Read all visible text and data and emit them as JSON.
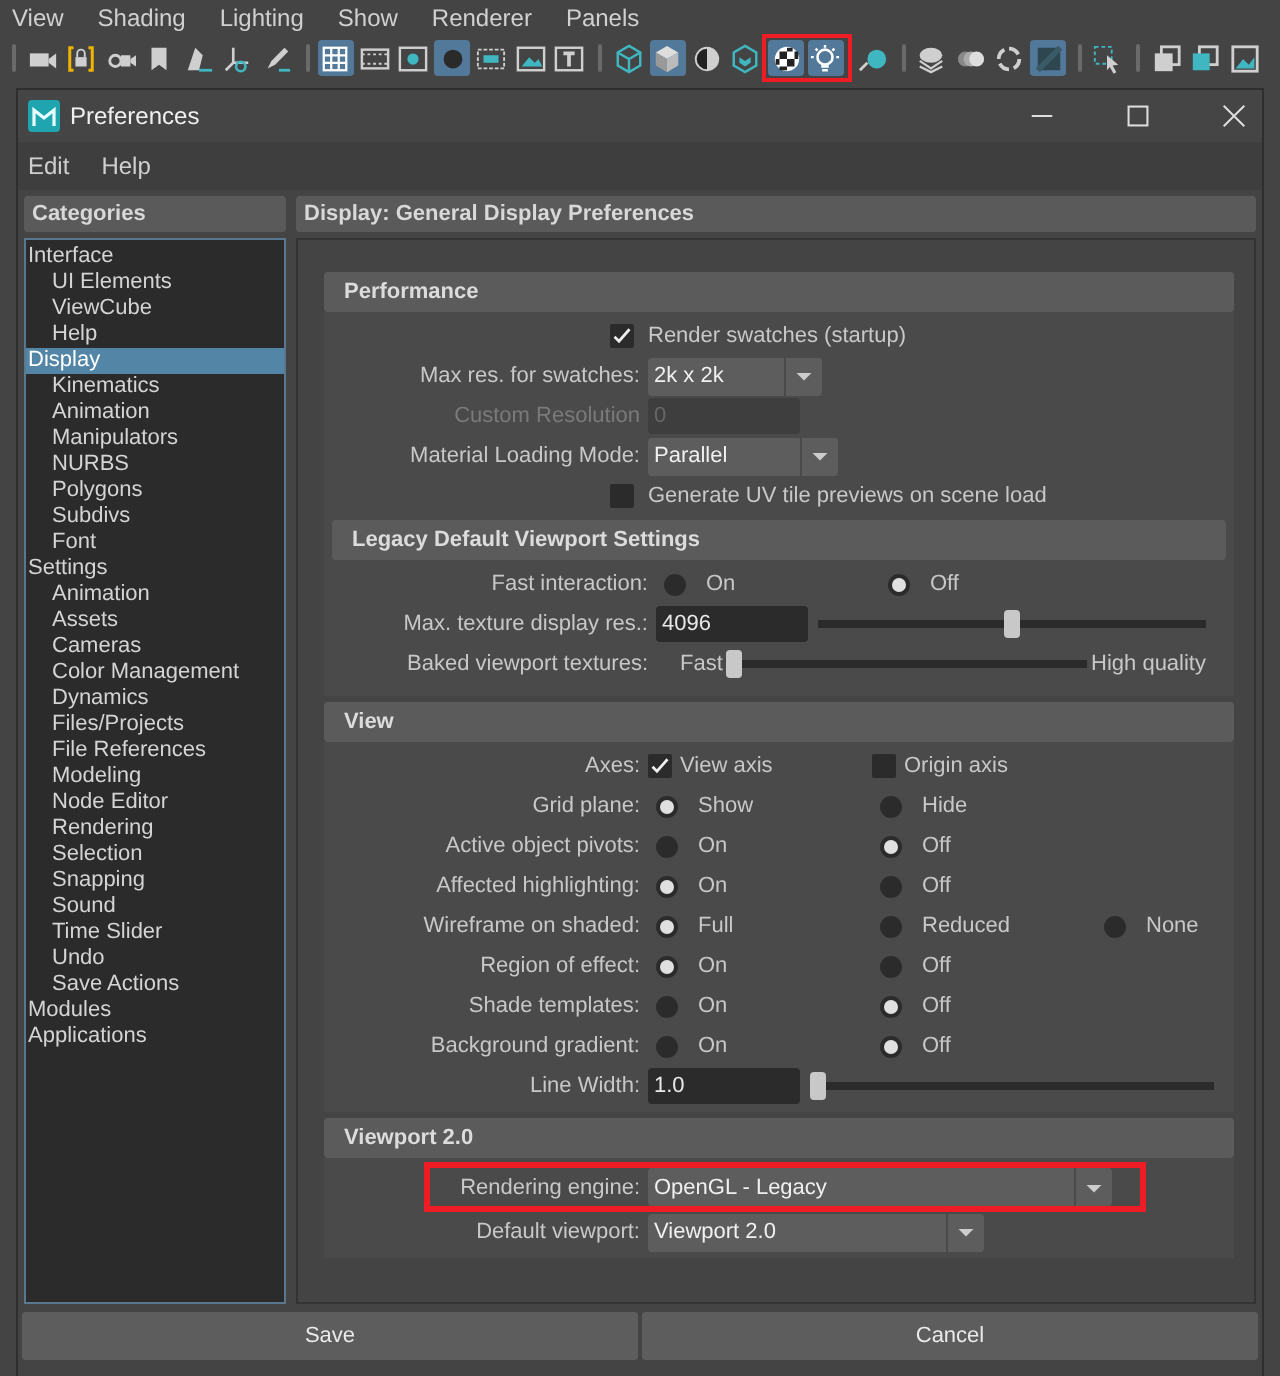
{
  "app_menu": [
    "View",
    "Shading",
    "Lighting",
    "Show",
    "Renderer",
    "Panels"
  ],
  "toolbar": [
    [
      {
        "selected": false
      },
      {
        "selected": false
      },
      {
        "selected": false
      },
      {
        "selected": false
      },
      {
        "selected": false
      },
      {
        "selected": false
      },
      {
        "selected": false
      }
    ],
    [
      {
        "selected": true
      },
      {
        "selected": false
      },
      {
        "selected": false
      },
      {
        "selected": true
      },
      {
        "selected": false
      },
      {
        "selected": false
      },
      {
        "selected": false
      }
    ],
    [
      {
        "selected": false
      },
      {
        "selected": true
      },
      {
        "selected": false
      },
      {
        "selected": false
      },
      {
        "selected": true,
        "highlighted": true
      },
      {
        "selected": true,
        "highlighted": true
      },
      {
        "selected": false
      }
    ],
    [
      {
        "selected": false
      },
      {
        "selected": false
      },
      {
        "selected": false
      },
      {
        "selected": true
      }
    ],
    [
      {
        "selected": false
      }
    ],
    [
      {
        "selected": false
      },
      {
        "selected": false
      },
      {
        "selected": false
      }
    ]
  ],
  "window": {
    "title": "Preferences"
  },
  "menu": [
    "Edit",
    "Help"
  ],
  "categories": {
    "title": "Categories",
    "items": [
      {
        "label": "Interface",
        "selected": false,
        "children": [
          {
            "label": "UI Elements",
            "selected": false
          },
          {
            "label": "ViewCube",
            "selected": false
          },
          {
            "label": "Help",
            "selected": false
          }
        ]
      },
      {
        "label": "Display",
        "selected": true,
        "children": [
          {
            "label": "Kinematics",
            "selected": false
          },
          {
            "label": "Animation",
            "selected": false
          },
          {
            "label": "Manipulators",
            "selected": false
          },
          {
            "label": "NURBS",
            "selected": false
          },
          {
            "label": "Polygons",
            "selected": false
          },
          {
            "label": "Subdivs",
            "selected": false
          },
          {
            "label": "Font",
            "selected": false
          }
        ]
      },
      {
        "label": "Settings",
        "selected": false,
        "children": [
          {
            "label": "Animation",
            "selected": false
          },
          {
            "label": "Assets",
            "selected": false
          },
          {
            "label": "Cameras",
            "selected": false
          },
          {
            "label": "Color Management",
            "selected": false
          },
          {
            "label": "Dynamics",
            "selected": false
          },
          {
            "label": "Files/Projects",
            "selected": false
          },
          {
            "label": "File References",
            "selected": false
          },
          {
            "label": "Modeling",
            "selected": false
          },
          {
            "label": "Node Editor",
            "selected": false
          },
          {
            "label": "Rendering",
            "selected": false
          },
          {
            "label": "Selection",
            "selected": false
          },
          {
            "label": "Snapping",
            "selected": false
          },
          {
            "label": "Sound",
            "selected": false
          },
          {
            "label": "Time Slider",
            "selected": false
          },
          {
            "label": "Undo",
            "selected": false
          },
          {
            "label": "Save Actions",
            "selected": false
          }
        ]
      },
      {
        "label": "Modules",
        "selected": false
      },
      {
        "label": "Applications",
        "selected": false
      }
    ]
  },
  "panel": {
    "title": "Display: General Display Preferences",
    "sections": [
      {
        "title": "Performance",
        "rows": [
          {
            "kind": "checkbox",
            "label": "Render swatches (startup)",
            "checked": true
          },
          {
            "kind": "dropdown",
            "label": "Max res. for swatches:",
            "value": "2k x 2k"
          },
          {
            "kind": "field",
            "label": "Custom Resolution",
            "value": "0",
            "disabled": true
          },
          {
            "kind": "dropdown",
            "label": "Material Loading Mode:",
            "value": "Parallel"
          },
          {
            "kind": "checkbox",
            "label": "Generate UV tile previews on scene load",
            "checked": false
          }
        ],
        "sections": [
          {
            "title": "Legacy Default Viewport Settings",
            "rows": [
              {
                "kind": "radio",
                "label": "Fast interaction:",
                "options": [
                  {
                    "label": "On",
                    "selected": false
                  },
                  {
                    "label": "Off",
                    "selected": true
                  }
                ]
              },
              {
                "kind": "field_slider",
                "label": "Max. texture display res.:",
                "value": "4096",
                "level": 0.5
              },
              {
                "kind": "slider",
                "label": "Baked viewport textures:",
                "min_label": "Fast",
                "max_label": "High quality",
                "level": 0
              }
            ]
          }
        ]
      },
      {
        "title": "View",
        "rows": [
          {
            "kind": "checks",
            "label": "Axes:",
            "options": [
              {
                "label": "View axis",
                "checked": true
              },
              {
                "label": "Origin axis",
                "checked": false
              }
            ]
          },
          {
            "kind": "radio",
            "label": "Grid plane:",
            "options": [
              {
                "label": "Show",
                "selected": true
              },
              {
                "label": "Hide",
                "selected": false
              }
            ]
          },
          {
            "kind": "radio",
            "label": "Active object pivots:",
            "options": [
              {
                "label": "On",
                "selected": false
              },
              {
                "label": "Off",
                "selected": true
              }
            ]
          },
          {
            "kind": "radio",
            "label": "Affected highlighting:",
            "options": [
              {
                "label": "On",
                "selected": true
              },
              {
                "label": "Off",
                "selected": false
              }
            ]
          },
          {
            "kind": "radio",
            "label": "Wireframe on shaded:",
            "options": [
              {
                "label": "Full",
                "selected": true
              },
              {
                "label": "Reduced",
                "selected": false
              },
              {
                "label": "None",
                "selected": false
              }
            ]
          },
          {
            "kind": "radio",
            "label": "Region of effect:",
            "options": [
              {
                "label": "On",
                "selected": true
              },
              {
                "label": "Off",
                "selected": false
              }
            ]
          },
          {
            "kind": "radio",
            "label": "Shade templates:",
            "options": [
              {
                "label": "On",
                "selected": false
              },
              {
                "label": "Off",
                "selected": true
              }
            ]
          },
          {
            "kind": "radio",
            "label": "Background gradient:",
            "options": [
              {
                "label": "On",
                "selected": false
              },
              {
                "label": "Off",
                "selected": true
              }
            ]
          },
          {
            "kind": "field_slider",
            "label": "Line Width:",
            "value": "1.0",
            "level": 0
          }
        ]
      },
      {
        "title": "Viewport 2.0",
        "rows": [
          {
            "kind": "dropdown",
            "label": "Rendering engine:",
            "value": "OpenGL - Legacy",
            "highlighted": true
          },
          {
            "kind": "dropdown",
            "label": "Default viewport:",
            "value": "Viewport 2.0"
          }
        ]
      }
    ]
  },
  "buttons": [
    "Save",
    "Cancel"
  ]
}
